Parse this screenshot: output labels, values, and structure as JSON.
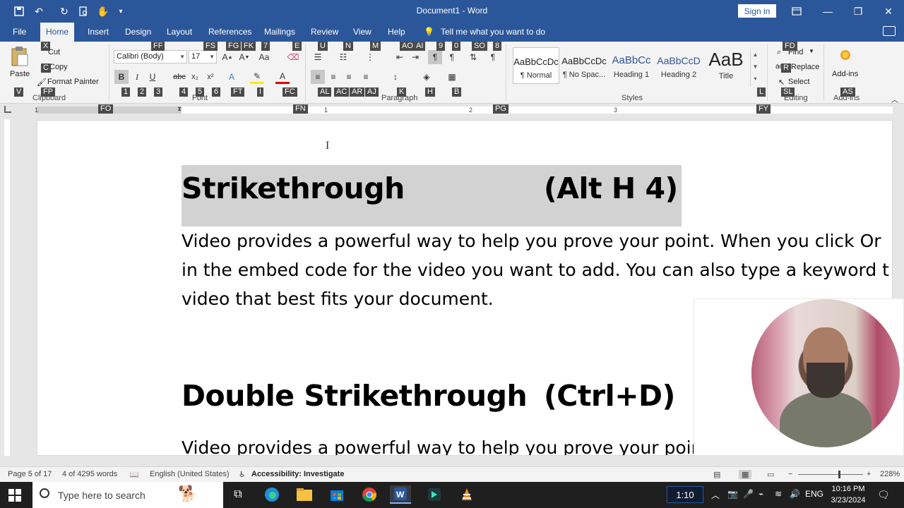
{
  "titlebar": {
    "doc_title": "Document1 - Word",
    "sign_in": "Sign in"
  },
  "tabs": [
    "File",
    "Home",
    "Insert",
    "Design",
    "Layout",
    "References",
    "Mailings",
    "Review",
    "View",
    "Help"
  ],
  "active_tab": "Home",
  "tell_me": "Tell me what you want to do",
  "ribbon": {
    "clipboard": {
      "paste": "Paste",
      "cut": "Cut",
      "copy": "Copy",
      "format_painter": "Format Painter",
      "label": "Clipboard"
    },
    "font": {
      "name": "Calibri (Body)",
      "size": "17",
      "label": "Font"
    },
    "paragraph": {
      "label": "Paragraph"
    },
    "styles": {
      "label": "Styles",
      "items": [
        {
          "sample": "AaBbCcDc",
          "name": "¶ Normal"
        },
        {
          "sample": "AaBbCcDc",
          "name": "¶ No Spac..."
        },
        {
          "sample": "AaBbCc",
          "name": "Heading 1"
        },
        {
          "sample": "AaBbCcD",
          "name": "Heading 2"
        },
        {
          "sample": "AaB",
          "name": "Title"
        }
      ]
    },
    "editing": {
      "find": "Find",
      "replace": "Replace",
      "select": "Select",
      "label": "Editing"
    },
    "addins": {
      "button": "Add-ins",
      "label": "Add-ins"
    }
  },
  "keytips": {
    "ff": "FF",
    "fs": "FS",
    "fg": "FG",
    "fk": "FK",
    "k7": "7",
    "e": "E",
    "u": "U",
    "n": "N",
    "m": "M",
    "ao": "AO",
    "ai": "AI",
    "k9": "9",
    "k0": "0",
    "so": "SO",
    "k8": "8",
    "x": "X",
    "c": "C",
    "v": "V",
    "fp": "FP",
    "k1": "1",
    "k2": "2",
    "k3": "3",
    "k4": "4",
    "k5": "5",
    "k6": "6",
    "ft": "FT",
    "i": "I",
    "fc": "FC",
    "al": "AL",
    "ac": "AC",
    "ar": "AR",
    "aj": "AJ",
    "k": "K",
    "h": "H",
    "b": "B",
    "l": "L",
    "fd": "FD",
    "r": "R",
    "sl": "SL",
    "as": "AS",
    "fo": "FO",
    "fn": "FN",
    "pg": "PG",
    "fy": "FY"
  },
  "ruler_numbers": [
    "1",
    "1",
    "2",
    "3"
  ],
  "document": {
    "heading1_left": "Strikethrough",
    "heading1_right": "(Alt H 4)",
    "para1_line1": "Video provides a powerful way to help you prove your point. When you click Or",
    "para1_line2": "in the embed code for the video you want to add. You can also type a keyword t",
    "para1_line3": "video that best fits your document.",
    "heading2_left": "Double Strikethrough",
    "heading2_right": "(Ctrl+D)",
    "para2_line1": "Video provides a powerful way to help you prove your point. When you click Or"
  },
  "status": {
    "page": "Page 5 of 17",
    "words": "4 of 4295 words",
    "language": "English (United States)",
    "accessibility": "Accessibility: Investigate",
    "zoom": "228%"
  },
  "taskbar": {
    "search_placeholder": "Type here to search",
    "timer": "1:10",
    "lang": "ENG",
    "time": "10:16 PM",
    "date": "3/23/2024"
  },
  "colors": {
    "word_blue": "#2b579a",
    "taskbar": "#1f1f1f",
    "selection": "#d2d2d2"
  }
}
